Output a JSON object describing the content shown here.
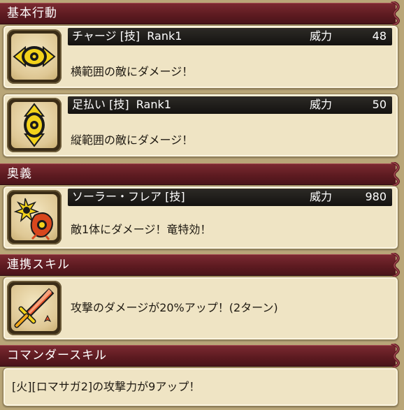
{
  "sections": {
    "basic": {
      "title": "基本行動",
      "skills": [
        {
          "name": "チャージ [技]  Rank1",
          "power_label": "威力",
          "power_value": "48",
          "description": "横範囲の敵にダメージ！",
          "icon": "horizontal-eye-icon"
        },
        {
          "name": "足払い [技]  Rank1",
          "power_label": "威力",
          "power_value": "50",
          "description": "縦範囲の敵にダメージ！",
          "icon": "vertical-eye-icon"
        }
      ]
    },
    "secret": {
      "title": "奥義",
      "skill": {
        "name": "ソーラー・フレア [技]",
        "power_label": "威力",
        "power_value": "980",
        "description": "敵1体にダメージ！竜特効！",
        "icon": "solar-flare-icon"
      }
    },
    "link": {
      "title": "連携スキル",
      "skill": {
        "description": "攻撃のダメージが20%アップ！(2ターン)",
        "icon": "sword-icon"
      }
    },
    "commander": {
      "title": "コマンダースキル",
      "description": "[火][ロマサガ2]の攻撃力が9アップ！"
    }
  },
  "colors": {
    "header": "#6b1f27",
    "card": "#efe4c4",
    "bar": "#1f1c19",
    "accent_yellow": "#f2d21b",
    "accent_red": "#d8471d"
  }
}
